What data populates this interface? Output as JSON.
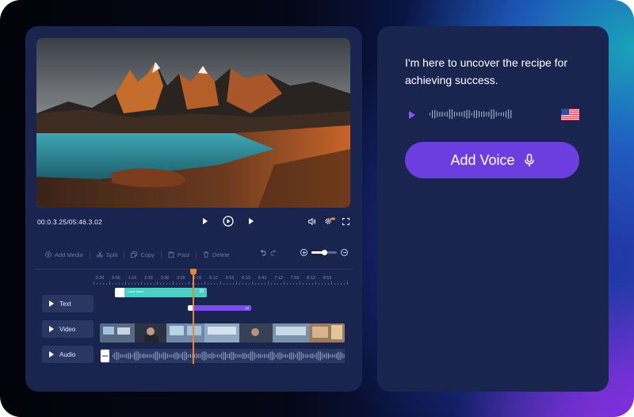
{
  "player": {
    "time": "00:0.3.25/05:46.3.02",
    "progress_fraction": 0.01
  },
  "toolbar": {
    "add_media": "Add Media",
    "split": "Split",
    "copy": "Copy",
    "paste": "Past",
    "delete": "Delete"
  },
  "zoom": {
    "level_fraction": 0.5
  },
  "ruler": {
    "labels": [
      "0:26",
      "0:56",
      "1:16",
      "2:16",
      "2:36",
      "3:26",
      "4:16",
      "5:12",
      "5:53",
      "6:13",
      "6:43",
      "7:12",
      "7:59",
      "8:12",
      "8:53"
    ]
  },
  "tracks": {
    "text": "Text",
    "video": "Video",
    "audio": "Audio"
  },
  "clips": {
    "text1_tag": "Lorem ipsum",
    "text1_end": "20",
    "text2_tag": "Lor",
    "text2_end": "20"
  },
  "voice": {
    "script": "I'm here to uncover the recipe for achieving success.",
    "add_voice_label": "Add Voice",
    "language_flag": "us-flag-icon"
  },
  "colors": {
    "panel": "#1a254f",
    "accent_purple": "#6c3ee0",
    "teal": "#4ecdc4",
    "playhead": "#e8833a"
  }
}
